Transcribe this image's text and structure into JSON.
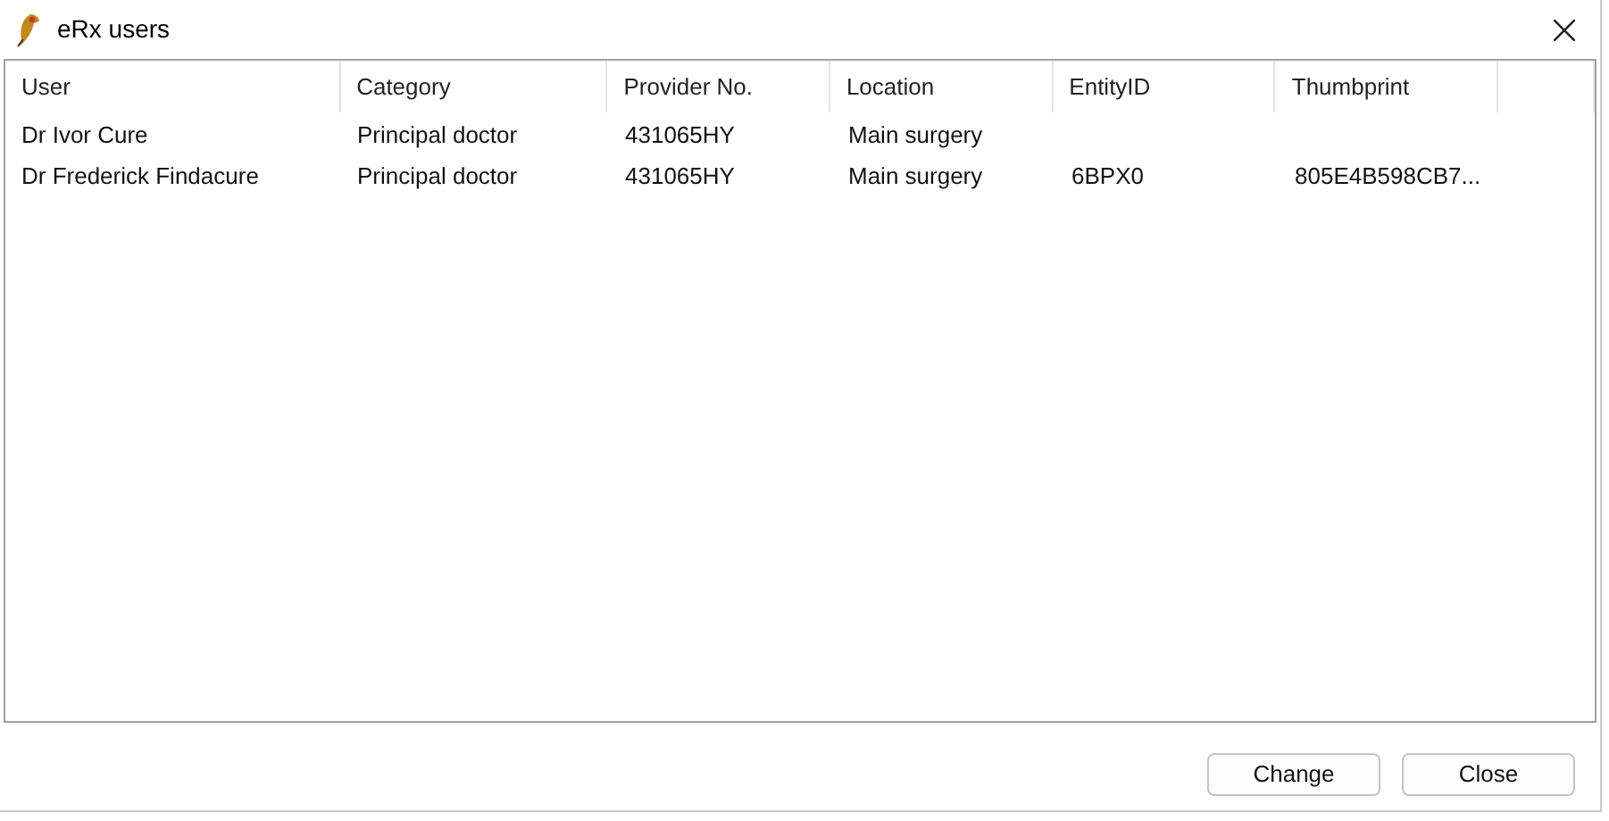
{
  "window": {
    "title": "eRx users"
  },
  "table": {
    "columns": [
      "User",
      "Category",
      "Provider No.",
      "Location",
      "EntityID",
      "Thumbprint"
    ],
    "rows": [
      [
        "Dr Ivor Cure",
        "Principal doctor",
        "431065HY",
        "Main surgery",
        "",
        ""
      ],
      [
        "Dr Frederick Findacure",
        "Principal doctor",
        "431065HY",
        "Main surgery",
        "6BPX0",
        "805E4B598CB7..."
      ]
    ]
  },
  "buttons": [
    "Change",
    "Close"
  ]
}
